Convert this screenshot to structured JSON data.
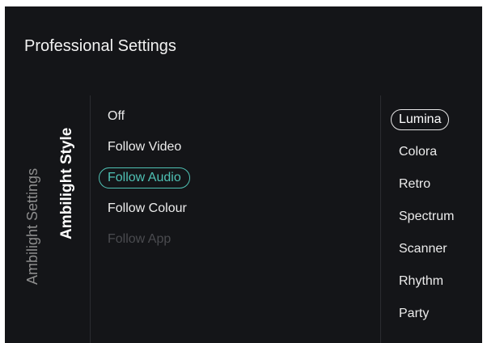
{
  "header": {
    "title": "Professional Settings"
  },
  "breadcrumb": {
    "parent": "Ambilight Settings",
    "current": "Ambilight Style"
  },
  "mode_options": [
    {
      "label": "Off",
      "state": "normal"
    },
    {
      "label": "Follow Video",
      "state": "normal"
    },
    {
      "label": "Follow Audio",
      "state": "selected"
    },
    {
      "label": "Follow Colour",
      "state": "normal"
    },
    {
      "label": "Follow App",
      "state": "disabled"
    }
  ],
  "style_options": [
    {
      "label": "Lumina",
      "state": "selected"
    },
    {
      "label": "Colora",
      "state": "normal"
    },
    {
      "label": "Retro",
      "state": "normal"
    },
    {
      "label": "Spectrum",
      "state": "normal"
    },
    {
      "label": "Scanner",
      "state": "normal"
    },
    {
      "label": "Rhythm",
      "state": "normal"
    },
    {
      "label": "Party",
      "state": "normal"
    }
  ],
  "colors": {
    "background": "#141518",
    "accent": "#4fc1b4",
    "disabled": "#4a4b4f"
  }
}
